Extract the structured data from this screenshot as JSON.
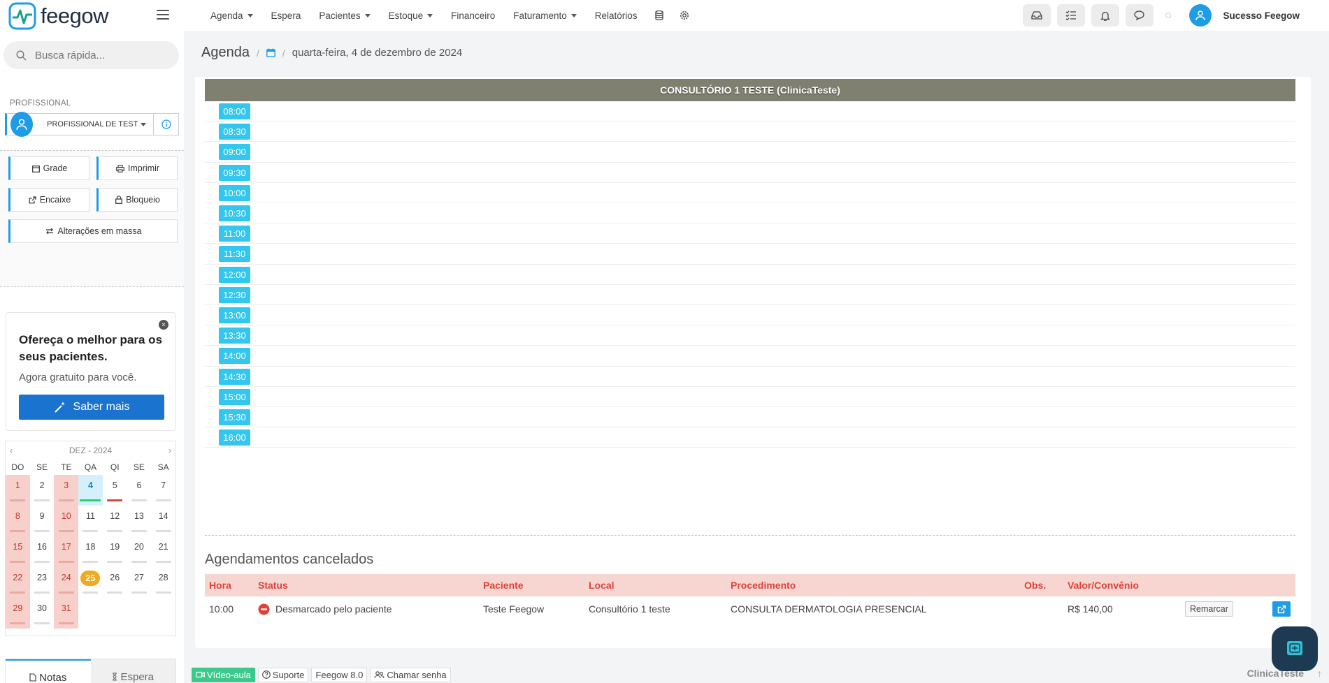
{
  "brand": {
    "name": "feegow",
    "accent": "#1f9ce6"
  },
  "nav": {
    "items": [
      {
        "label": "Agenda",
        "dropdown": true
      },
      {
        "label": "Espera",
        "dropdown": false
      },
      {
        "label": "Pacientes",
        "dropdown": true
      },
      {
        "label": "Estoque",
        "dropdown": true
      },
      {
        "label": "Financeiro",
        "dropdown": false
      },
      {
        "label": "Faturamento",
        "dropdown": true
      },
      {
        "label": "Relatórios",
        "dropdown": false
      }
    ],
    "icons": [
      "database-icon",
      "gear-icon"
    ],
    "tools": [
      "inbox-icon",
      "tasks-icon",
      "bell-icon",
      "chat-icon"
    ],
    "user_name": "Sucesso Feegow"
  },
  "sidebar": {
    "search_placeholder": "Busca rápida...",
    "prof_label": "PROFISSIONAL",
    "prof_name": "PROFISSIONAL DE TEST",
    "actions": {
      "grade": "Grade",
      "imprimir": "Imprimir",
      "encaixe": "Encaixe",
      "bloqueio": "Bloqueio",
      "alteracoes": "Alterações em massa"
    },
    "promo": {
      "title": "Ofereça o melhor para os seus pacientes.",
      "subtitle": "Agora gratuito para você.",
      "button": "Saber mais"
    },
    "calendar": {
      "month_label": "DEZ - 2024",
      "dow": [
        "DO",
        "SE",
        "TE",
        "QA",
        "QI",
        "SE",
        "SA"
      ],
      "selected_day": "4",
      "highlight_day": "25",
      "weekend_days": [
        "1",
        "3",
        "8",
        "10",
        "15",
        "17",
        "22",
        "24",
        "29",
        "31"
      ]
    },
    "tabs": {
      "notas": "Notas",
      "espera": "Espera"
    }
  },
  "main": {
    "breadcrumb_title": "Agenda",
    "breadcrumb_date": "quarta-feira, 4 de dezembro de 2024",
    "room_header": "CONSULTÓRIO 1 TESTE (ClinicaTeste)",
    "slots": [
      "08:00",
      "08:30",
      "09:00",
      "09:30",
      "10:00",
      "10:30",
      "11:00",
      "11:30",
      "12:00",
      "12:30",
      "13:00",
      "13:30",
      "14:00",
      "14:30",
      "15:00",
      "15:30",
      "16:00"
    ],
    "cancel": {
      "title": "Agendamentos cancelados",
      "headers": {
        "hora": "Hora",
        "status": "Status",
        "paciente": "Paciente",
        "local": "Local",
        "procedimento": "Procedimento",
        "obs": "Obs.",
        "valor": "Valor/Convênio"
      },
      "row": {
        "hora": "10:00",
        "status": "Desmarcado pelo paciente",
        "paciente": "Teste Feegow",
        "local": "Consultório 1 teste",
        "procedimento": "CONSULTA DERMATOLOGIA PRESENCIAL",
        "valor": "R$ 140,00",
        "remarcar": "Remarcar"
      }
    }
  },
  "footer": {
    "video": "Vídeo-aula",
    "suporte": "Suporte",
    "version": "Feegow 8.0",
    "chamar": "Chamar senha",
    "clinic": "ClinicaTeste"
  }
}
